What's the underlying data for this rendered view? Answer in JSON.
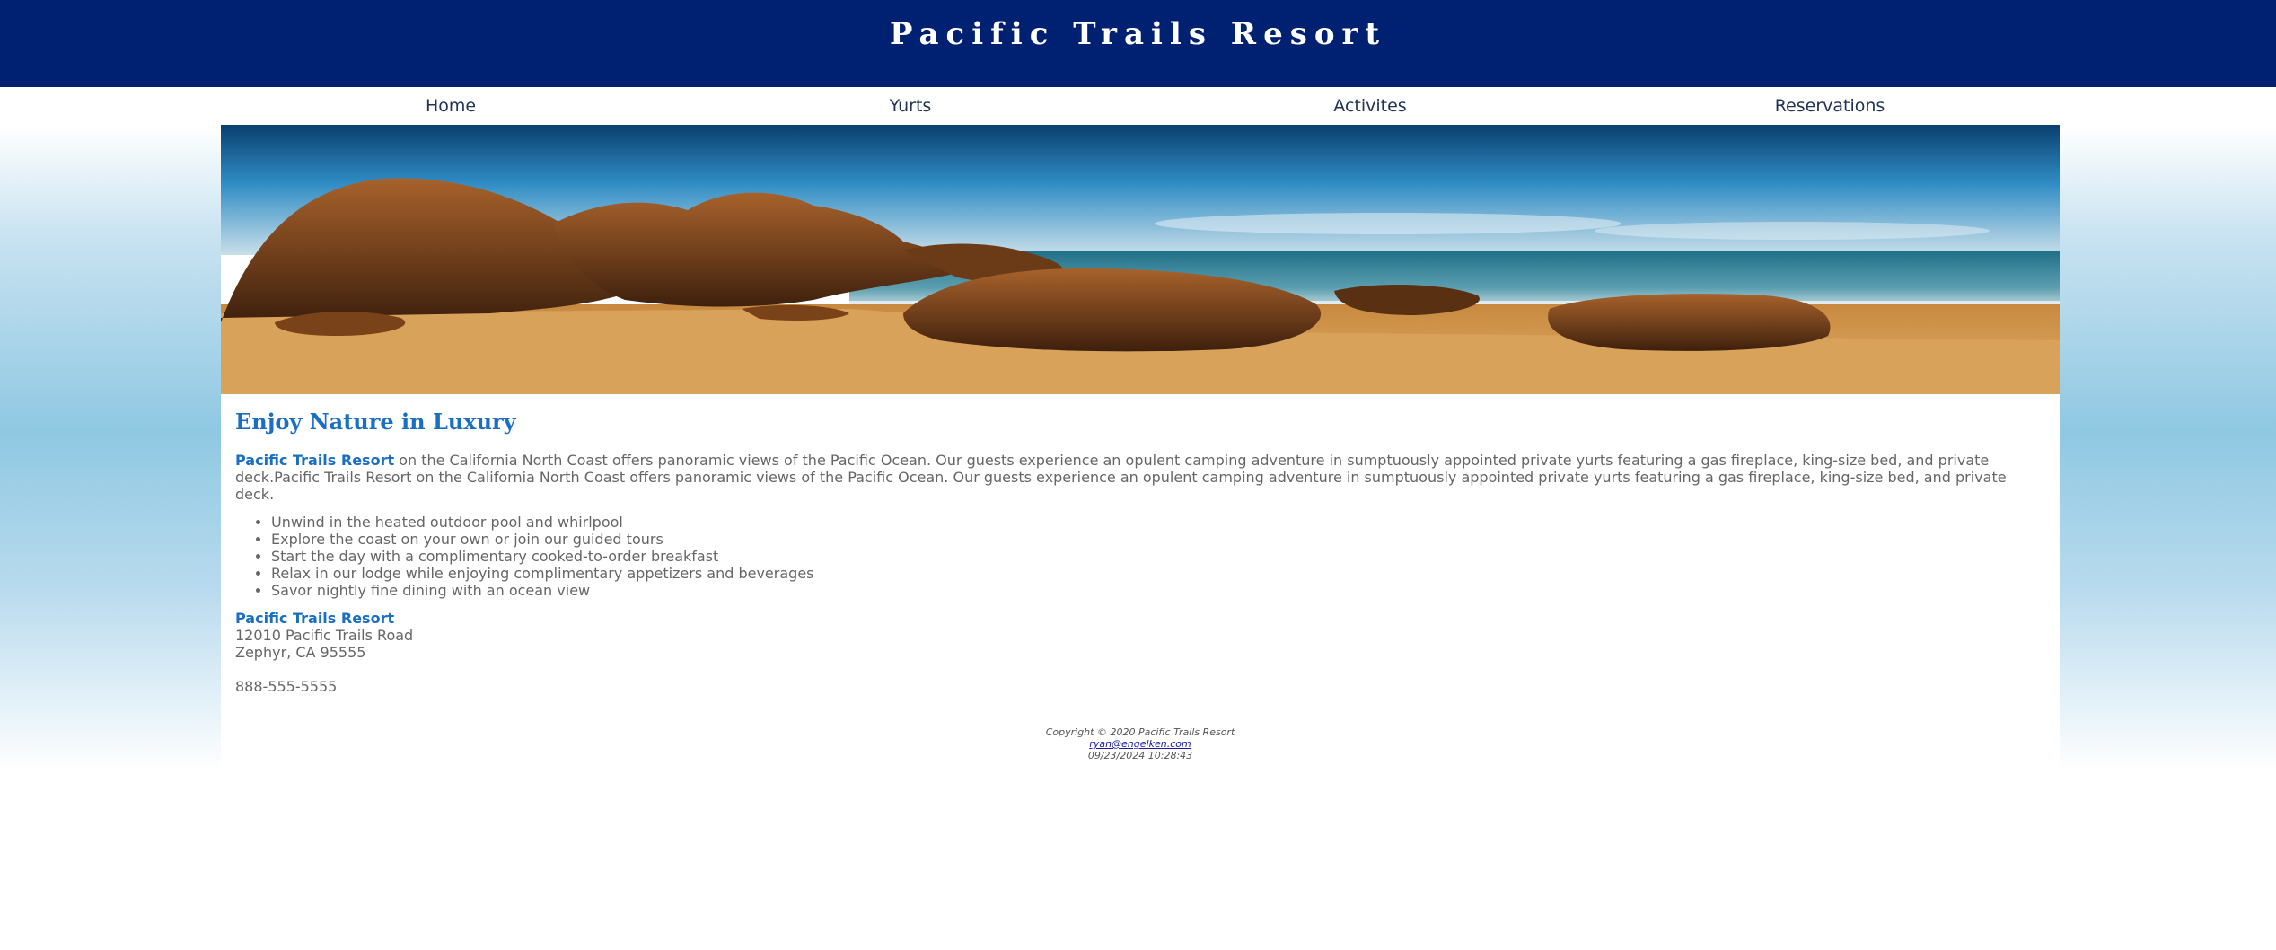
{
  "header": {
    "title": "Pacific Trails Resort"
  },
  "nav": {
    "items": [
      {
        "label": "Home"
      },
      {
        "label": "Yurts"
      },
      {
        "label": "Activites"
      },
      {
        "label": "Reservations"
      }
    ]
  },
  "main": {
    "heading": "Enjoy Nature in Luxury",
    "intro": {
      "resort_name": "Pacific Trails Resort",
      "text": " on the California North Coast offers panoramic views of the Pacific Ocean. Our guests experience an opulent camping adventure in sumptuously appointed private yurts featuring a gas fireplace, king-size bed, and private deck.Pacific Trails Resort on the California North Coast offers panoramic views of the Pacific Ocean. Our guests experience an opulent camping adventure in sumptuously appointed private yurts featuring a gas fireplace, king-size bed, and private deck."
    },
    "features": [
      "Unwind in the heated outdoor pool and whirlpool",
      "Explore the coast on your own or join our guided tours",
      "Start the day with a complimentary cooked-to-order breakfast",
      "Relax in our lodge while enjoying complimentary appetizers and beverages",
      "Savor nightly fine dining with an ocean view"
    ],
    "contact": {
      "name": "Pacific Trails Resort",
      "street": "12010 Pacific Trails Road",
      "city": "Zephyr, CA 95555",
      "phone": "888-555-5555"
    }
  },
  "footer": {
    "copyright": "Copyright © 2020 Pacific Trails Resort",
    "email": "ryan@engelken.com",
    "timestamp": "09/23/2024 10:28:43"
  },
  "colors": {
    "header_bg": "#002171",
    "accent": "#1a6fc2",
    "body_text": "#666666"
  }
}
